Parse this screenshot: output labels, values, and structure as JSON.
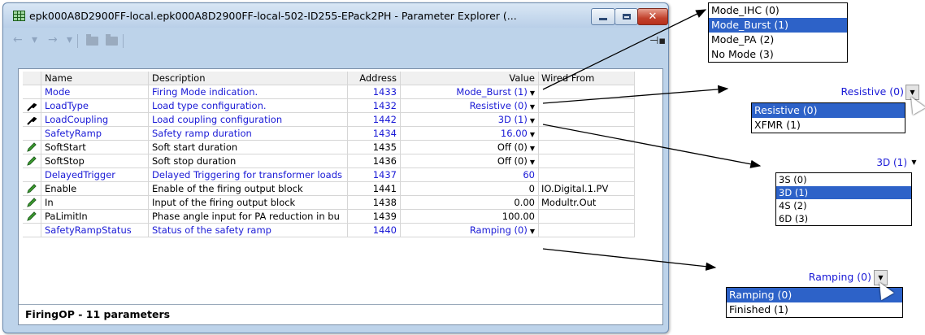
{
  "window": {
    "title": "epk000A8D2900FF-local.epk000A8D2900FF-local-502-ID255-EPack2PH - Parameter Explorer (..."
  },
  "toolbar": {
    "back_glyph": "←",
    "forward_glyph": "→",
    "dropdown_glyph": "▾",
    "pin_glyph": "⊣▪"
  },
  "grid": {
    "columns": [
      "Name",
      "Description",
      "Address",
      "Value",
      "Wired From"
    ],
    "rows": [
      {
        "icon": "",
        "name": "Mode",
        "description": "Firing Mode indication.",
        "address": "1433",
        "value": "Mode_Burst (1)",
        "dropdown": true,
        "wired": "",
        "blue": true
      },
      {
        "icon": "wrench",
        "name": "LoadType",
        "description": "Load type configuration.",
        "address": "1432",
        "value": "Resistive (0)",
        "dropdown": true,
        "wired": "",
        "blue": true
      },
      {
        "icon": "wrench",
        "name": "LoadCoupling",
        "description": "Load coupling configuration",
        "address": "1442",
        "value": "3D (1)",
        "dropdown": true,
        "wired": "",
        "blue": true
      },
      {
        "icon": "",
        "name": "SafetyRamp",
        "description": "Safety ramp duration",
        "address": "1434",
        "value": "16.00",
        "dropdown": true,
        "wired": "",
        "blue": true
      },
      {
        "icon": "pencil",
        "name": "SoftStart",
        "description": "Soft start duration",
        "address": "1435",
        "value": "Off (0)",
        "dropdown": true,
        "wired": "",
        "blue": false
      },
      {
        "icon": "pencil",
        "name": "SoftStop",
        "description": "Soft stop duration",
        "address": "1436",
        "value": "Off (0)",
        "dropdown": true,
        "wired": "",
        "blue": false
      },
      {
        "icon": "",
        "name": "DelayedTrigger",
        "description": "Delayed Triggering for transformer loads",
        "address": "1437",
        "value": "60",
        "dropdown": false,
        "wired": "",
        "blue": true
      },
      {
        "icon": "pencil",
        "name": "Enable",
        "description": "Enable of the firing output block",
        "address": "1441",
        "value": "0",
        "dropdown": false,
        "wired": "IO.Digital.1.PV",
        "blue": false
      },
      {
        "icon": "pencil",
        "name": "In",
        "description": "Input of the firing output block",
        "address": "1438",
        "value": "0.00",
        "dropdown": false,
        "wired": "Modultr.Out",
        "blue": false
      },
      {
        "icon": "pencil",
        "name": "PaLimitIn",
        "description": "Phase angle input for PA reduction in bu",
        "address": "1439",
        "value": "100.00",
        "dropdown": false,
        "wired": "",
        "blue": false
      },
      {
        "icon": "",
        "name": "SafetyRampStatus",
        "description": "Status of the safety ramp",
        "address": "1440",
        "value": "Ramping (0)",
        "dropdown": true,
        "wired": "",
        "blue": true
      }
    ]
  },
  "status": {
    "text": "FiringOP  -  11 parameters"
  },
  "callouts": {
    "mode": {
      "items": [
        "Mode_IHC (0)",
        "Mode_Burst (1)",
        "Mode_PA (2)",
        "No Mode (3)"
      ],
      "selected": 1
    },
    "loadtype": {
      "value": "Resistive (0)",
      "items": [
        "Resistive (0)",
        "XFMR (1)"
      ],
      "selected": 0
    },
    "coupling": {
      "value": "3D (1)",
      "items": [
        "3S (0)",
        "3D (1)",
        "4S (2)",
        "6D (3)"
      ],
      "selected": 1
    },
    "ramp": {
      "value": "Ramping (0)",
      "items": [
        "Ramping (0)",
        "Finished (1)"
      ],
      "selected": 0
    }
  },
  "colors": {
    "param_blue": "#1a1ad6",
    "selection": "#2d62c8",
    "frame": "#bdd3ea"
  }
}
